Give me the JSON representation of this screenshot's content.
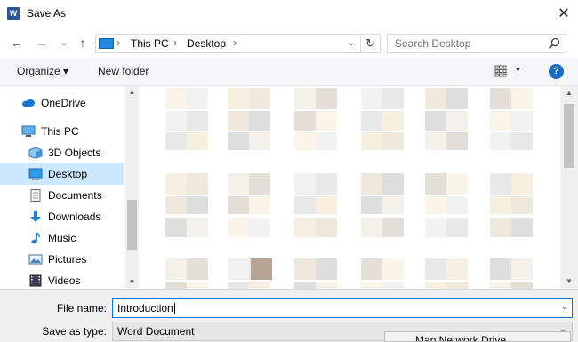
{
  "window": {
    "title": "Save As",
    "app_icon_letter": "W",
    "close_glyph": "✕"
  },
  "nav": {
    "back": "←",
    "forward": "→",
    "recent": "⌄",
    "up": "↑",
    "breadcrumb": [
      "This PC",
      "Desktop"
    ],
    "separator": "›",
    "refresh": "↻",
    "dropdown": "⌄"
  },
  "search": {
    "placeholder": "Search Desktop"
  },
  "toolbar": {
    "organize": "Organize ▾",
    "new_folder": "New folder",
    "view_dropdown": "▼",
    "help": "?"
  },
  "sidebar": {
    "items": [
      {
        "label": "OneDrive",
        "icon": "onedrive-icon"
      },
      {
        "label": "This PC",
        "icon": "pc-icon"
      },
      {
        "label": "3D Objects",
        "icon": "cube-icon"
      },
      {
        "label": "Desktop",
        "icon": "desktop-icon",
        "selected": true
      },
      {
        "label": "Documents",
        "icon": "documents-icon"
      },
      {
        "label": "Downloads",
        "icon": "downloads-icon"
      },
      {
        "label": "Music",
        "icon": "music-icon"
      },
      {
        "label": "Pictures",
        "icon": "pictures-icon"
      },
      {
        "label": "Videos",
        "icon": "videos-icon"
      }
    ]
  },
  "scroll_arrows": {
    "up": "▲",
    "down": "▼"
  },
  "form": {
    "file_name_label": "File name:",
    "file_name_value": "Introduction",
    "save_as_type_label": "Save as type:",
    "save_as_type_value": "Word Document",
    "dropdown_glyph": "⌄"
  },
  "popup": {
    "text": "Map Network Drive..."
  },
  "colors": {
    "accent": "#0078d7",
    "selected": "#cce8ff",
    "word_blue": "#2b579a",
    "help_blue": "#1a6dc6"
  }
}
